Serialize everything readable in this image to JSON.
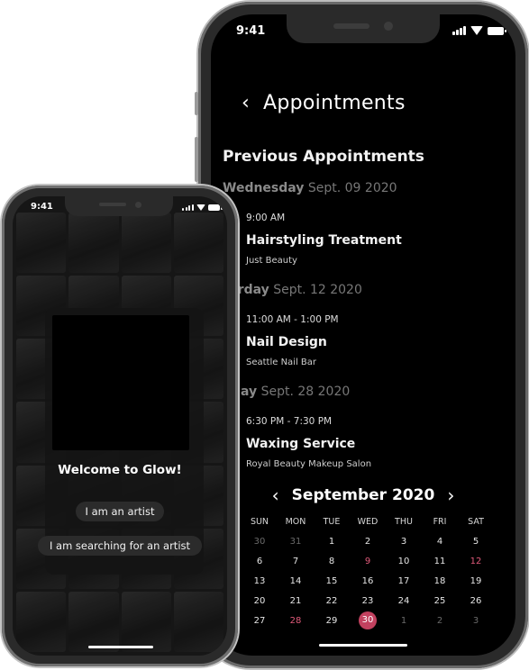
{
  "appointments_screen": {
    "status_time": "9:41",
    "back_icon": "‹",
    "title": "Appointments",
    "section_title": "Previous Appointments",
    "appointments": [
      {
        "weekday": "Wednesday",
        "date": "Sept. 09 2020",
        "time": "9:00 AM",
        "service": "Hairstyling Treatment",
        "place": "Just Beauty"
      },
      {
        "weekday": "turday",
        "date": "Sept. 12 2020",
        "time": "11:00 AM - 1:00 PM",
        "service": "Nail Design",
        "place": "Seattle Nail Bar"
      },
      {
        "weekday": "nday",
        "date": "Sept. 28 2020",
        "time": "6:30 PM - 7:30 PM",
        "service": "Waxing Service",
        "place": "Royal Beauty Makeup Salon"
      }
    ],
    "calendar": {
      "prev_icon": "‹",
      "next_icon": "›",
      "month_label": "September 2020",
      "weekdays": [
        "SUN",
        "MON",
        "TUE",
        "WED",
        "THU",
        "FRI",
        "SAT"
      ],
      "weeks": [
        [
          "30",
          "31",
          "1",
          "2",
          "3",
          "4",
          "5"
        ],
        [
          "6",
          "7",
          "8",
          "9",
          "10",
          "11",
          "12"
        ],
        [
          "13",
          "14",
          "15",
          "16",
          "17",
          "18",
          "19"
        ],
        [
          "20",
          "21",
          "22",
          "23",
          "24",
          "25",
          "26"
        ],
        [
          "27",
          "28",
          "29",
          "30",
          "1",
          "2",
          "3"
        ]
      ],
      "selected_day": "30",
      "highlighted_days": [
        "9",
        "12",
        "28"
      ],
      "accent_color": "#c2415f",
      "highlight_color": "#e05a7a"
    }
  },
  "welcome_screen": {
    "status_time": "9:41",
    "welcome_text": "Welcome to Glow!",
    "artist_button": "I am an artist",
    "search_button": "I am searching for an artist"
  }
}
